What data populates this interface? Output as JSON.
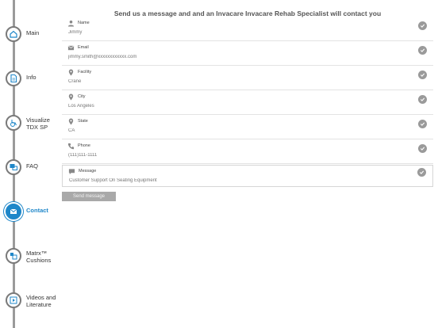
{
  "sidebar": {
    "items": [
      {
        "label": "Main",
        "icon": "home-icon"
      },
      {
        "label": "Info",
        "icon": "document-icon"
      },
      {
        "label": "Visualize\nTDX SP",
        "icon": "wheelchair-icon"
      },
      {
        "label": "FAQ",
        "icon": "chat-icon"
      },
      {
        "label": "Contact",
        "icon": "mail-icon",
        "active": true
      },
      {
        "label": "Matrx™\nCushions",
        "icon": "cushion-icon"
      },
      {
        "label": "Videos and\nLiterature",
        "icon": "video-icon"
      }
    ]
  },
  "form": {
    "heading": "Send us a message and and an Invacare Invacare Rehab Specialist will contact you",
    "fields": [
      {
        "label": "Name",
        "placeholder": "Jimmy",
        "icon": "person-icon"
      },
      {
        "label": "Email",
        "placeholder": "jimmy.smith@xxxxxxxxxxxx.com",
        "icon": "envelope-icon"
      },
      {
        "label": "Facility",
        "placeholder": "Crane",
        "icon": "location-pin-icon"
      },
      {
        "label": "City",
        "placeholder": "Los Angeles",
        "icon": "location-pin-icon"
      },
      {
        "label": "State",
        "placeholder": "CA",
        "icon": "location-pin-icon"
      },
      {
        "label": "Phone",
        "placeholder": "(111)111-1111",
        "icon": "phone-icon"
      },
      {
        "label": "Message",
        "placeholder": "Customer Support On Seating Equipment",
        "icon": "message-icon"
      }
    ],
    "send_label": "Send message"
  },
  "colors": {
    "accent": "#1f87c9",
    "check": "#9a9a9a",
    "button": "#a9a9a9"
  }
}
